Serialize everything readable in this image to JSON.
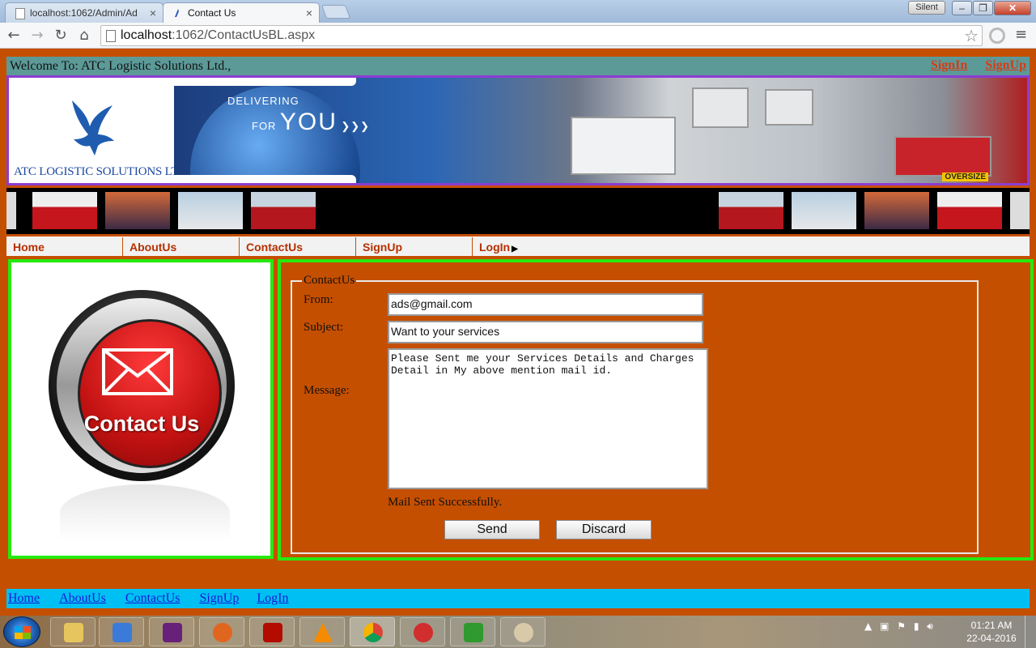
{
  "browser": {
    "tabs": [
      {
        "title": "localhost:1062/Admin/Ad",
        "active": false
      },
      {
        "title": "Contact Us",
        "active": true
      }
    ],
    "silent_badge": "Silent",
    "address": {
      "host": "localhost",
      "path": ":1062/ContactUsBL.aspx"
    }
  },
  "header": {
    "welcome": "Welcome To: ATC Logistic Solutions Ltd.,",
    "signin": "SignIn",
    "signup": "SignUp"
  },
  "banner": {
    "logo_text": "ATC LOGISTIC SOLUTIONS LTD.,",
    "tagline_small": "DELIVERING",
    "tagline_for": "FOR",
    "tagline_big": "YOU",
    "oversize": "OVERSIZE"
  },
  "menu": [
    {
      "label": "Home"
    },
    {
      "label": "AboutUs"
    },
    {
      "label": "ContactUs"
    },
    {
      "label": "SignUp"
    },
    {
      "label": "LogIn"
    }
  ],
  "contact_image_text": "Contact Us",
  "form": {
    "legend": "ContactUs",
    "from_label": "From:",
    "from_value": "ads@gmail.com",
    "subject_label": "Subject:",
    "subject_value": "Want to your services",
    "message_label": "Message:",
    "message_value": "Please Sent me your Services Details and Charges\nDetail in My above mention mail id.",
    "status": "Mail Sent Successfully.",
    "send": "Send",
    "discard": "Discard"
  },
  "footer_links": [
    "Home",
    "AboutUs",
    "ContactUs",
    "SignUp",
    "LogIn"
  ],
  "taskbar": {
    "time": "01:21 AM",
    "date": "22-04-2016"
  },
  "colors": {
    "page_bg": "#c54f00",
    "panel_border": "#27e80f",
    "welcome_bar": "#5c9a98",
    "footer_bar": "#00bff3",
    "banner_border": "#8c3cd2"
  }
}
